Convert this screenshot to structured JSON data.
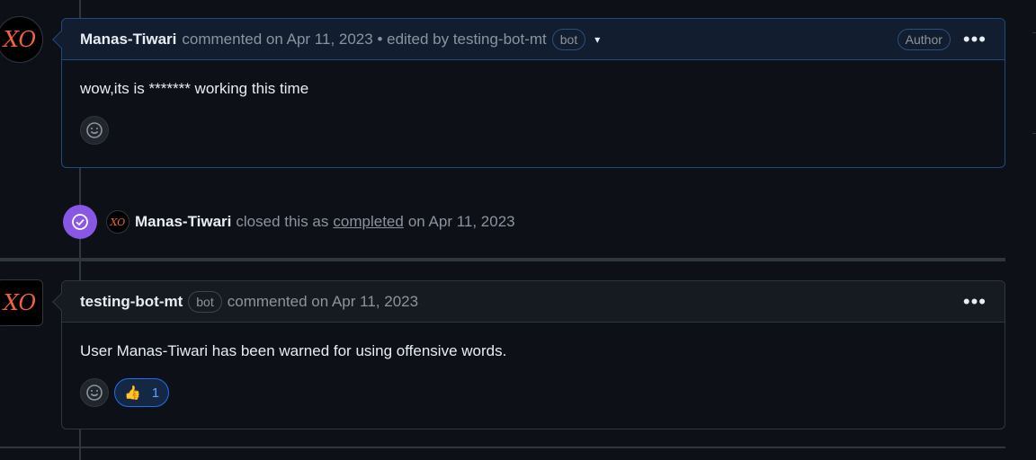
{
  "comment1": {
    "username": "Manas-Tiwari",
    "meta": "commented on Apr 11, 2023 • edited by testing-bot-mt",
    "bot_badge": "bot",
    "author_badge": "Author",
    "body": "wow,its is ******* working this time"
  },
  "event": {
    "username": "Manas-Tiwari",
    "text_before": "closed this as",
    "link": "completed",
    "text_after": "on Apr 11, 2023"
  },
  "comment2": {
    "username": "testing-bot-mt",
    "bot_badge": "bot",
    "meta": "commented on Apr 11, 2023",
    "body": "User Manas-Tiwari has been warned for using offensive words.",
    "reaction": {
      "emoji": "👍",
      "count": "1"
    }
  },
  "avatar_text": "XO",
  "colors": {
    "accent": "#8957e5",
    "link": "#58a6ff",
    "avatar_text": "#f0633c"
  },
  "icons": {
    "smiley": "smiley-icon",
    "check": "check-circle-icon",
    "kebab": "kebab-horizontal-icon",
    "caret": "triangle-down-icon"
  }
}
